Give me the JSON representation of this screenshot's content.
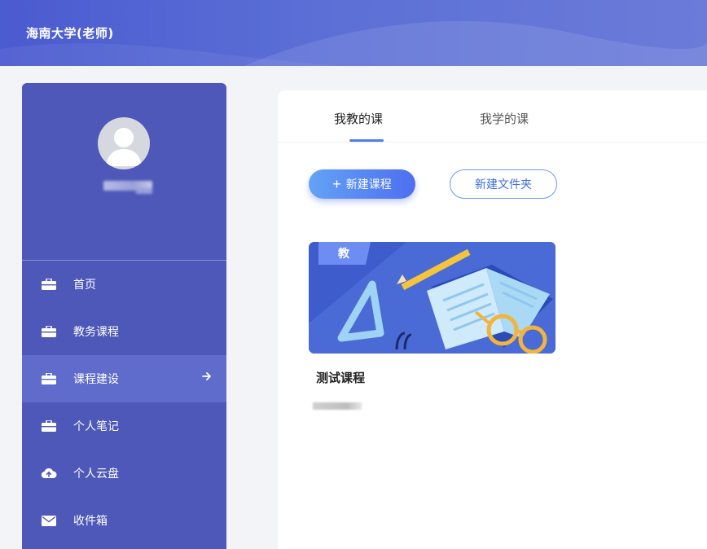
{
  "header": {
    "title": "海南大学(老师)"
  },
  "sidebar": {
    "menu": [
      {
        "label": "首页",
        "icon": "briefcase-icon"
      },
      {
        "label": "教务课程",
        "icon": "briefcase-icon"
      },
      {
        "label": "课程建设",
        "icon": "briefcase-icon",
        "active": true
      },
      {
        "label": "个人笔记",
        "icon": "briefcase-icon"
      },
      {
        "label": "个人云盘",
        "icon": "cloud-upload-icon"
      },
      {
        "label": "收件箱",
        "icon": "envelope-icon"
      }
    ]
  },
  "main": {
    "tabs": [
      {
        "label": "我教的课",
        "active": true
      },
      {
        "label": "我学的课"
      }
    ],
    "actions": {
      "new_course": "新建课程",
      "new_folder": "新建文件夹"
    },
    "courses": [
      {
        "badge": "教",
        "name": "测试课程"
      }
    ]
  },
  "colors": {
    "header": "#5b6fd6",
    "sidebar": "#4d58b8",
    "sidebar_active": "#5f6ccb",
    "accent": "#4f7ef0"
  }
}
